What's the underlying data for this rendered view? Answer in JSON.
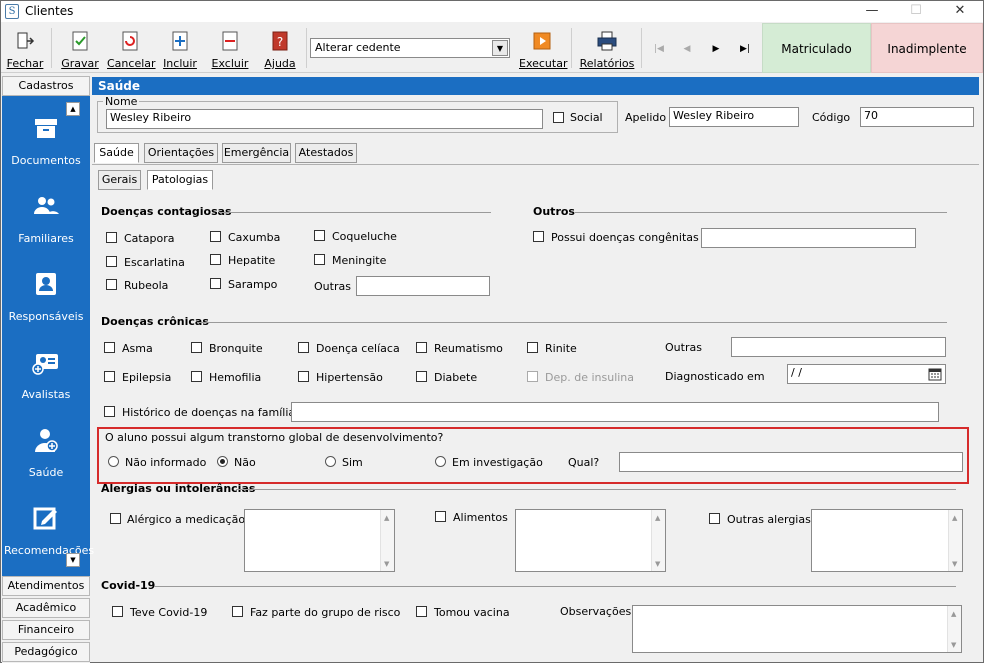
{
  "window": {
    "title": "Clientes",
    "logo": "S"
  },
  "toolbar": {
    "buttons": [
      "Fechar",
      "Gravar",
      "Cancelar",
      "Incluir",
      "Excluir",
      "Ajuda"
    ],
    "cedente": "Alterar cedente",
    "executar": "Executar",
    "relatorios": "Relatórios",
    "status_ok": "Matriculado",
    "status_bad": "Inadimplente"
  },
  "sidebar": {
    "top": "Cadastros",
    "items": [
      "Documentos",
      "Familiares",
      "Responsáveis",
      "Avalistas",
      "Saúde",
      "Recomendações"
    ],
    "bottom": [
      "Atendimentos",
      "Acadêmico",
      "Financeiro",
      "Pedagógico"
    ]
  },
  "section": {
    "title": "Saúde"
  },
  "header": {
    "nome_label": "Nome",
    "nome": "Wesley Ribeiro",
    "social": "Social",
    "apelido_label": "Apelido",
    "apelido": "Wesley Ribeiro",
    "codigo_label": "Código",
    "codigo": "70"
  },
  "tabs": [
    "Saúde",
    "Orientações",
    "Emergência",
    "Atestados"
  ],
  "subtabs": [
    "Gerais",
    "Patologias"
  ],
  "contagiosas": {
    "title": "Doenças contagiosas",
    "items": [
      "Catapora",
      "Caxumba",
      "Coqueluche",
      "Escarlatina",
      "Hepatite",
      "Meningite",
      "Rubeola",
      "Sarampo"
    ],
    "outras": "Outras"
  },
  "outros": {
    "title": "Outros",
    "congenitas": "Possui doenças congênitas"
  },
  "cronicas": {
    "title": "Doenças crônicas",
    "items": [
      "Asma",
      "Bronquite",
      "Doença celíaca",
      "Reumatismo",
      "Rinite",
      "Epilepsia",
      "Hemofilia",
      "Hipertensão",
      "Diabete",
      "Dep. de insulina"
    ],
    "outras": "Outras",
    "diag_label": "Diagnosticado em",
    "diag_value": " / /",
    "historico": "Histórico de doenças na família"
  },
  "transtorno": {
    "question": "O aluno possui algum transtorno global de desenvolvimento?",
    "options": [
      "Não informado",
      "Não",
      "Sim",
      "Em investigação"
    ],
    "qual": "Qual?"
  },
  "alergias": {
    "title": "Alergias ou intolerâncias",
    "items": [
      "Alérgico a medicação",
      "Alimentos",
      "Outras alergias"
    ]
  },
  "covid": {
    "title": "Covid-19",
    "items": [
      "Teve Covid-19",
      "Faz parte do grupo de risco",
      "Tomou vacina"
    ],
    "obs": "Observações"
  }
}
